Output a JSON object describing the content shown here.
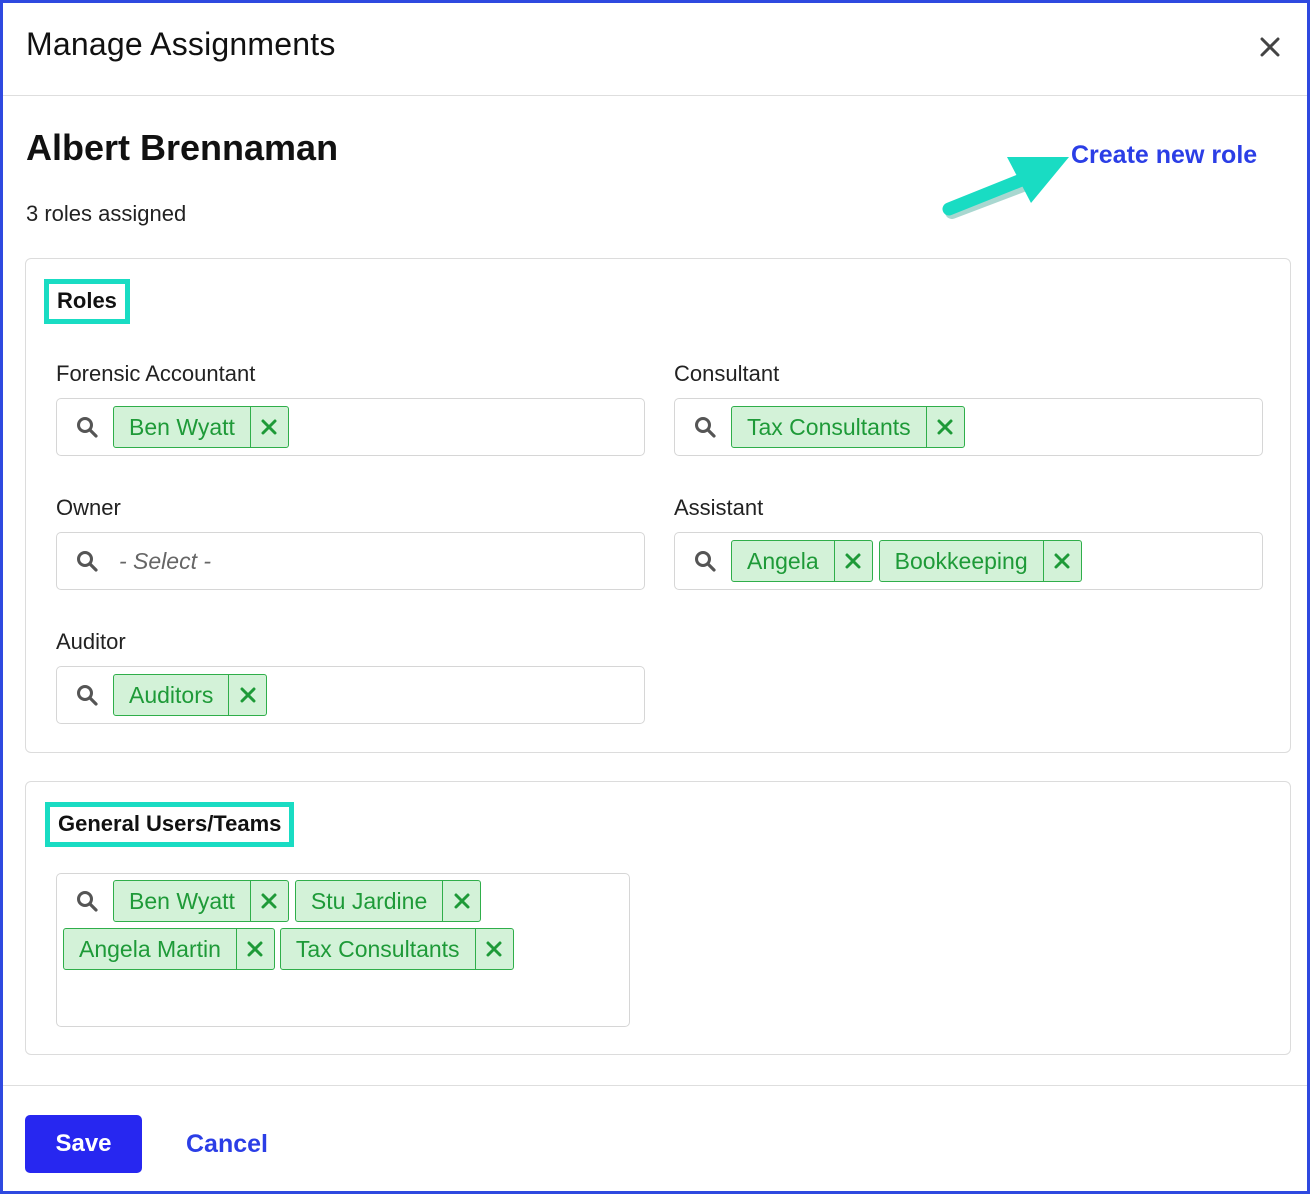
{
  "modal": {
    "title": "Manage Assignments",
    "close_icon": "close-icon"
  },
  "person": {
    "name": "Albert Brennaman",
    "roles_assigned": "3 roles assigned"
  },
  "create_role_label": "Create new role",
  "roles_section": {
    "title": "Roles",
    "fields": [
      {
        "label": "Forensic Accountant",
        "chips": [
          "Ben Wyatt"
        ]
      },
      {
        "label": "Consultant",
        "chips": [
          "Tax Consultants"
        ]
      },
      {
        "label": "Owner",
        "placeholder": "- Select -",
        "chips": []
      },
      {
        "label": "Assistant",
        "chips": [
          "Angela",
          "Bookkeeping"
        ]
      },
      {
        "label": "Auditor",
        "chips": [
          "Auditors"
        ]
      }
    ]
  },
  "users_section": {
    "title": "General Users/Teams",
    "chips": [
      "Ben Wyatt",
      "Stu Jardine",
      "Angela Martin",
      "Tax Consultants"
    ]
  },
  "footer": {
    "save_label": "Save",
    "cancel_label": "Cancel"
  },
  "colors": {
    "accent": "#2727f0",
    "link": "#2b3ee6",
    "highlight": "#19dcc3",
    "chip_bg": "#d3f2d8",
    "chip_text": "#1e9a38"
  }
}
